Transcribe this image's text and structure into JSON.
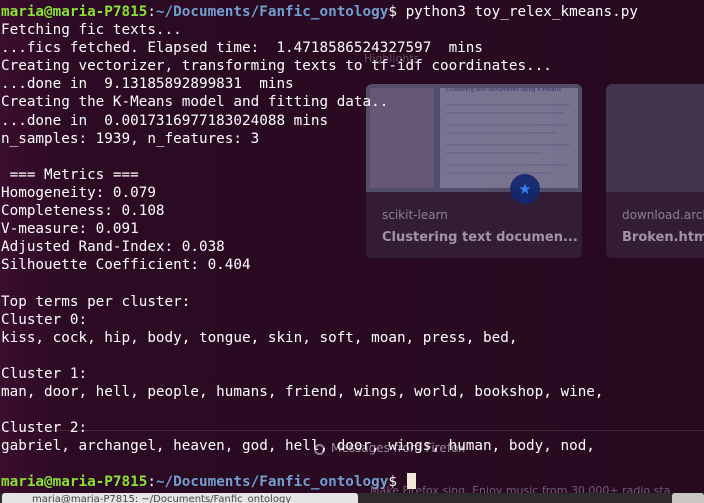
{
  "terminal": {
    "prompt": {
      "user_host": "maria@maria-P7815",
      "path": "~/Documents/Fanfic_ontology",
      "symbol": "$"
    },
    "command": "python3 toy_relex_kmeans.py",
    "output": [
      "Fetching fic texts...",
      "...fics fetched. Elapsed time:  1.4718586524327597  mins",
      "Creating vectorizer, transforming texts to tf-idf coordinates...",
      "...done in  9.13185892899831  mins",
      "Creating the K-Means model and fitting data..",
      "...done in  0.0017316977183024088 mins",
      "n_samples: 1939, n_features: 3",
      "",
      " === Metrics ===",
      "Homogeneity: 0.079",
      "Completeness: 0.108",
      "V-measure: 0.091",
      "Adjusted Rand-Index: 0.038",
      "Silhouette Coefficient: 0.404",
      "",
      "Top terms per cluster:",
      "Cluster 0:",
      "kiss, cock, hip, body, tongue, skin, soft, moan, press, bed,",
      "",
      "Cluster 1:",
      "man, door, hell, people, humans, friend, wings, world, bookshop, wine,",
      "",
      "Cluster 2:",
      "gabriel, archangel, heaven, god, hell, door, wings, human, body, nod,",
      ""
    ],
    "final_prompt": {
      "user_host": "maria@maria-P7815",
      "path": "~/Documents/Fanfic_ontology",
      "symbol": "$"
    }
  },
  "background_browser": {
    "highlights_label": "Highlights",
    "cards": [
      {
        "source": "scikit-learn",
        "title": "Clustering text documen...",
        "doc_title": "Clustering text documents using k-means"
      },
      {
        "source": "download.arch",
        "title": "Broken.html"
      }
    ],
    "messages_label": "Messages from Firefox",
    "footer_text": "Make Firefox sing. Enjoy music from 30,000+ radio sta"
  },
  "taskbar": {
    "window_label": "maria@maria-P7815: ~/Documents/Fanfic_ontology"
  },
  "colors": {
    "prompt_user": "#8ae234",
    "prompt_path": "#729fcf",
    "terminal_bg": "#2c0a24",
    "text": "#ffffff"
  }
}
